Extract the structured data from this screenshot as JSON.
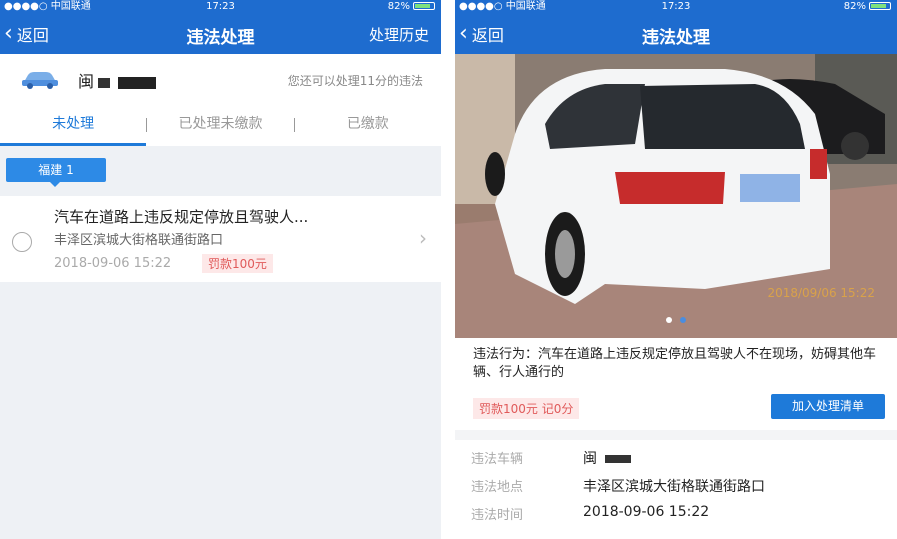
{
  "status_bar": {
    "carrier": "●●●●○ 中国联通",
    "time": "17:23",
    "battery": "82%"
  },
  "left_screen": {
    "nav": {
      "back_label": "返回",
      "title": "违法处理",
      "history_label": "处理历史"
    },
    "plate": {
      "prefix": "闽",
      "remaining_text": "您还可以处理11分的违法"
    },
    "tabs": [
      {
        "label": "未处理",
        "active": true
      },
      {
        "label": "已处理未缴款",
        "active": false
      },
      {
        "label": "已缴款",
        "active": false
      }
    ],
    "province_tag": "福建 1",
    "record": {
      "title": "汽车在道路上违反规定停放且驾驶人...",
      "location": "丰泽区滨城大街格联通街路口",
      "time": "2018-09-06 15:22",
      "fine": "罚款100元"
    }
  },
  "right_screen": {
    "nav": {
      "back_label": "返回",
      "title": "违法处理"
    },
    "photo_timestamp": "2018/09/06 15:22",
    "description": "违法行为：汽车在道路上违反规定停放且驾驶人不在现场，妨碍其他车辆、行人通行的",
    "fine_points": "罚款100元  记0分",
    "add_button": "加入处理清单",
    "details": [
      {
        "label": "违法车辆",
        "value": "闽"
      },
      {
        "label": "违法地点",
        "value": "丰泽区滨城大街格联通街路口"
      },
      {
        "label": "违法时间",
        "value": "2018-09-06 15:22"
      }
    ]
  },
  "colors": {
    "nav_blue": "#1e6ccf",
    "accent_blue": "#1e7ad9",
    "fine_red": "#e05a5a"
  }
}
